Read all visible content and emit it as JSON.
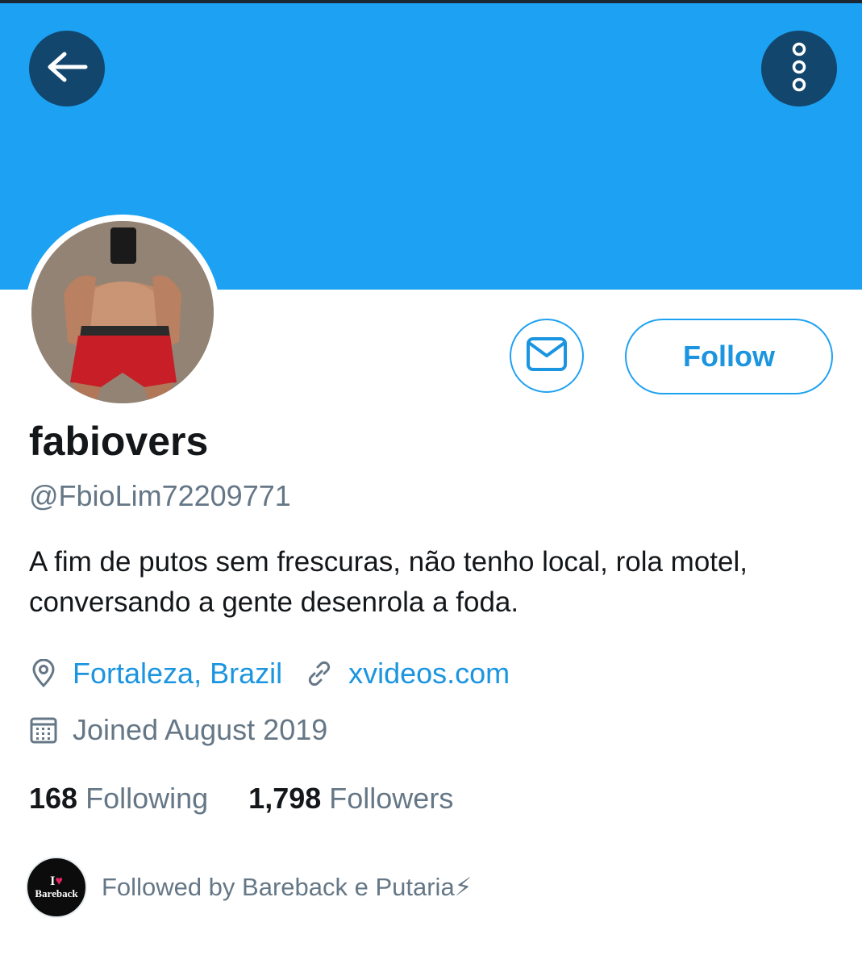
{
  "header": {
    "back_icon": "arrow-left-icon",
    "more_icon": "more-vertical-icon",
    "banner_color": "#1da1f2",
    "button_color": "#12466d"
  },
  "profile": {
    "display_name": "fabiovers",
    "handle": "@FbioLim72209771",
    "bio": "A fim de putos sem frescuras, não tenho local, rola motel, conversando a gente desenrola a foda.",
    "location": "Fortaleza, Brazil",
    "website": "xvideos.com",
    "joined": "Joined August 2019"
  },
  "actions": {
    "follow_label": "Follow",
    "message_icon": "envelope-icon",
    "accent_color": "#1da1f2"
  },
  "stats": {
    "following_count": "168",
    "following_label": "Following",
    "followers_count": "1,798",
    "followers_label": "Followers"
  },
  "followed_by": {
    "text": "Followed by Bareback e Putaria⚡",
    "avatar_line1": "I",
    "avatar_line2": "Bareback"
  }
}
